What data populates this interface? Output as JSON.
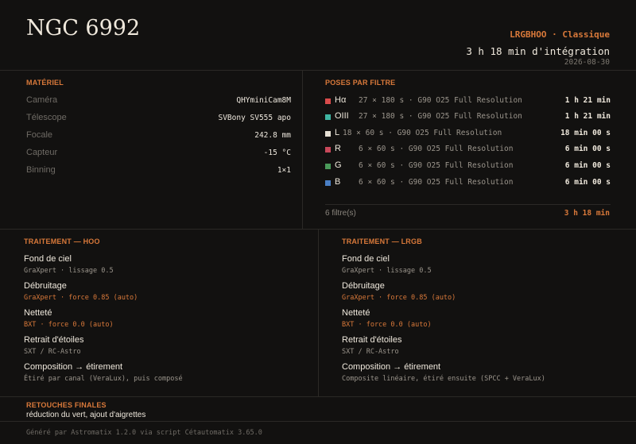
{
  "header": {
    "title": "NGC 6992",
    "preset": "LRGBHOO · Classique",
    "integration": "3 h 18 min d'intégration",
    "date": "2026-08-30"
  },
  "equipment": {
    "title": "MATÉRIEL",
    "rows": [
      {
        "label": "Caméra",
        "value": "QHYminiCam8M"
      },
      {
        "label": "Télescope",
        "value": "SVBony SV555 apo"
      },
      {
        "label": "Focale",
        "value": "242.8 mm"
      },
      {
        "label": "Capteur",
        "value": "-15 °C"
      },
      {
        "label": "Binning",
        "value": "1×1"
      }
    ]
  },
  "filters": {
    "title": "POSES PAR FILTRE",
    "rows": [
      {
        "name": "Hα",
        "color": "#d94b4b",
        "detail": "27 × 180 s · G90 O25 Full Resolution",
        "duration": "1 h 21 min"
      },
      {
        "name": "OIII",
        "color": "#3fb5a2",
        "detail": "27 × 180 s · G90 O25 Full Resolution",
        "duration": "1 h 21 min"
      },
      {
        "name": "L",
        "color": "#e6e0d4",
        "detail": "18 × 60 s · G90 O25 Full Resolution",
        "duration": "18 min 00 s"
      },
      {
        "name": "R",
        "color": "#c8485a",
        "detail": "6 × 60 s · G90 O25 Full Resolution",
        "duration": "6 min 00 s"
      },
      {
        "name": "G",
        "color": "#4a9a5a",
        "detail": "6 × 60 s · G90 O25 Full Resolution",
        "duration": "6 min 00 s"
      },
      {
        "name": "B",
        "color": "#4a7fc4",
        "detail": "6 × 60 s · G90 O25 Full Resolution",
        "duration": "6 min 00 s"
      }
    ],
    "count": "6 filtre(s)",
    "total": "3 h 18 min"
  },
  "treatment_hoo": {
    "title": "TRAITEMENT — HOO",
    "steps": [
      {
        "title": "Fond de ciel",
        "detail": "GraXpert · lissage 0.5",
        "highlight": false
      },
      {
        "title": "Débruitage",
        "detail": "GraXpert · force 0.85 (auto)",
        "highlight": true
      },
      {
        "title": "Netteté",
        "detail": "BXT · force 0.0 (auto)",
        "highlight": true
      },
      {
        "title": "Retrait d'étoiles",
        "detail": "SXT / RC-Astro",
        "highlight": false
      },
      {
        "title": "Composition → étirement",
        "detail": "Étiré par canal (VeraLux), puis composé",
        "highlight": false
      }
    ]
  },
  "treatment_lrgb": {
    "title": "TRAITEMENT — LRGB",
    "steps": [
      {
        "title": "Fond de ciel",
        "detail": "GraXpert · lissage 0.5",
        "highlight": false
      },
      {
        "title": "Débruitage",
        "detail": "GraXpert · force 0.85 (auto)",
        "highlight": true
      },
      {
        "title": "Netteté",
        "detail": "BXT · force 0.0 (auto)",
        "highlight": true
      },
      {
        "title": "Retrait d'étoiles",
        "detail": "SXT / RC-Astro",
        "highlight": false
      },
      {
        "title": "Composition → étirement",
        "detail": "Composite linéaire, étiré ensuite (SPCC + VeraLux)",
        "highlight": false
      }
    ]
  },
  "retouch": {
    "title": "RETOUCHES FINALES",
    "text": "réduction du vert, ajout d'aigrettes"
  },
  "footer": {
    "text": "Généré par Astromatix 1.2.0 via script Cétautomatix 3.65.0"
  }
}
